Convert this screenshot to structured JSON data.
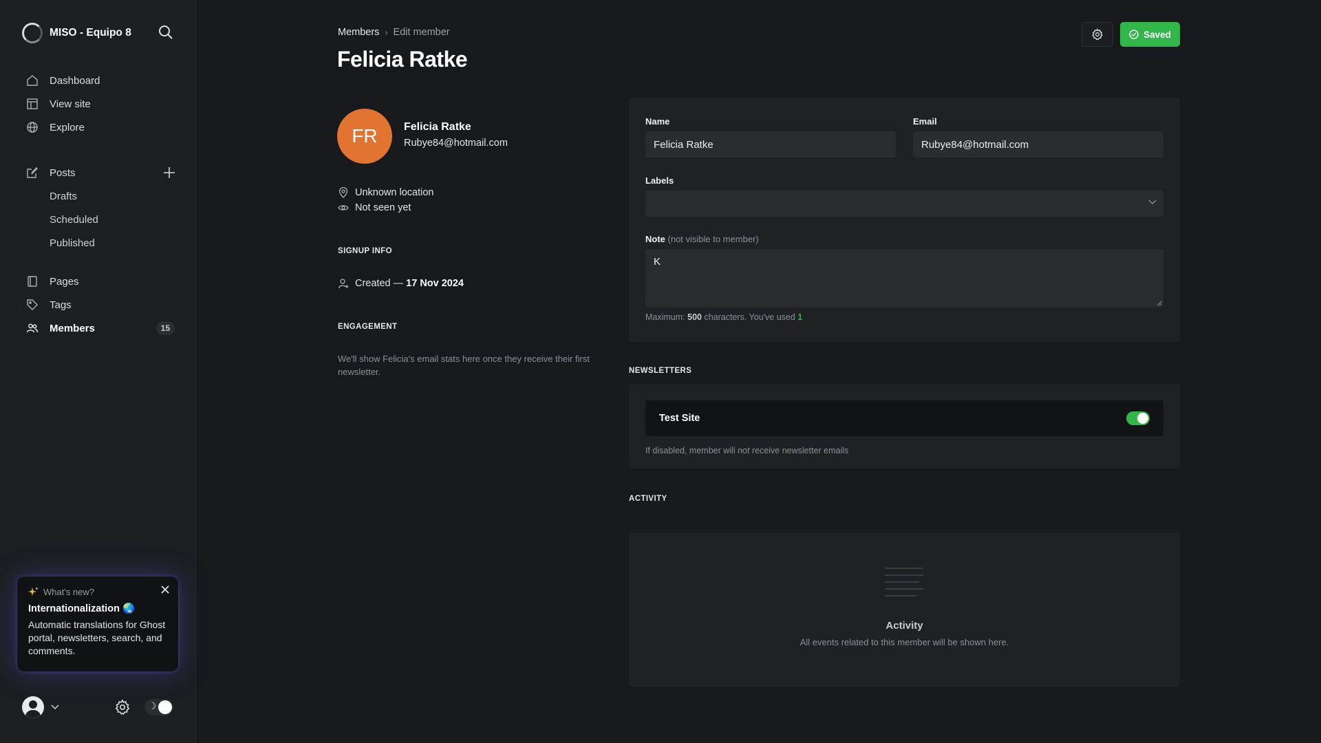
{
  "sidebar": {
    "site_title": "MISO - Equipo 8",
    "nav": {
      "dashboard": "Dashboard",
      "view_site": "View site",
      "explore": "Explore",
      "posts": "Posts",
      "drafts": "Drafts",
      "scheduled": "Scheduled",
      "published": "Published",
      "pages": "Pages",
      "tags": "Tags",
      "members": "Members",
      "members_count": "15"
    },
    "whats_new": {
      "header": "What's new?",
      "title": "Internationalization 🌏",
      "body": "Automatic translations for Ghost portal, newsletters, search, and comments."
    }
  },
  "header": {
    "breadcrumb_parent": "Members",
    "breadcrumb_current": "Edit member",
    "title": "Felicia Ratke",
    "saved_label": "Saved"
  },
  "member": {
    "initials": "FR",
    "name": "Felicia Ratke",
    "email": "Rubye84@hotmail.com",
    "location": "Unknown location",
    "seen": "Not seen yet",
    "signup_heading": "SIGNUP INFO",
    "created_prefix": "Created — ",
    "created_date": "17 Nov 2024",
    "engagement_heading": "ENGAGEMENT",
    "engagement_text": "We'll show Felicia's email stats here once they receive their first newsletter."
  },
  "form": {
    "name_label": "Name",
    "name_value": "Felicia Ratke",
    "email_label": "Email",
    "email_value": "Rubye84@hotmail.com",
    "labels_label": "Labels",
    "note_label": "Note",
    "note_muted": "(not visible to member)",
    "note_value": "K",
    "hint_prefix": "Maximum: ",
    "hint_max": "500",
    "hint_mid": " characters. You've used ",
    "hint_used": "1"
  },
  "newsletters": {
    "heading": "NEWSLETTERS",
    "name": "Test Site",
    "enabled": true,
    "hint_prefix": "If disabled, member will ",
    "hint_em": "not",
    "hint_suffix": " receive newsletter emails"
  },
  "activity": {
    "heading": "ACTIVITY",
    "title": "Activity",
    "subtitle": "All events related to this member will be shown here."
  },
  "colors": {
    "accent_green": "#30b649",
    "avatar_orange": "#e27432",
    "background": "#17191d"
  }
}
